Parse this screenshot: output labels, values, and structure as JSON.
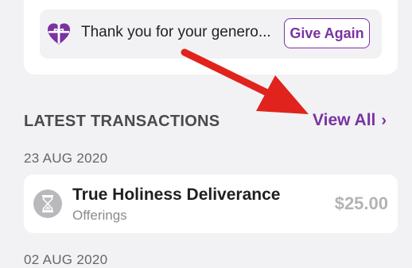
{
  "thank_you": {
    "message": "Thank you for your genero...",
    "button_label": "Give Again",
    "icon": "gift-heart-icon"
  },
  "transactions_section": {
    "title": "LATEST TRANSACTIONS",
    "view_all_label": "View All",
    "view_all_icon": "chevron-right-icon"
  },
  "transactions": [
    {
      "date": "23 AUG 2020",
      "name": "True Holiness Deliverance",
      "category": "Offerings",
      "amount": "$25.00",
      "icon": "hourglass-icon"
    }
  ],
  "next_date": "02 AUG 2020",
  "colors": {
    "accent": "#7a33a0",
    "background": "#f2f2f4",
    "card": "#ffffff",
    "annotation_arrow": "#e0231c"
  }
}
